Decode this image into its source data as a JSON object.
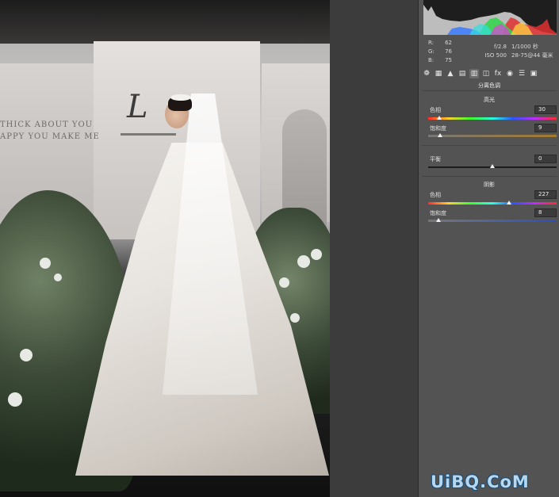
{
  "canvas": {
    "wall_text_line1": "THICK ABOUT YOU",
    "wall_text_line2": "APPY YOU MAKE ME",
    "monogram": "L"
  },
  "histogram": {
    "type": "rgb-histogram"
  },
  "readout": {
    "r_label": "R:",
    "r_value": "62",
    "g_label": "G:",
    "g_value": "76",
    "b_label": "B:",
    "b_value": "75",
    "aperture": "f/2.8",
    "shutter": "1/1000 秒",
    "iso": "ISO 500",
    "lens": "28-75@44 毫米"
  },
  "tabs": [
    {
      "icon": "aperture-icon",
      "glyph": "❁"
    },
    {
      "icon": "tone-curve-icon",
      "glyph": "▦"
    },
    {
      "icon": "detail-icon",
      "glyph": "▲"
    },
    {
      "icon": "hsl-icon",
      "glyph": "▤"
    },
    {
      "icon": "split-toning-icon",
      "glyph": "▥"
    },
    {
      "icon": "lens-corrections-icon",
      "glyph": "◫"
    },
    {
      "icon": "effects-icon",
      "glyph": "fx"
    },
    {
      "icon": "camera-calibration-icon",
      "glyph": "◉"
    },
    {
      "icon": "presets-icon",
      "glyph": "☰"
    },
    {
      "icon": "snapshots-icon",
      "glyph": "▣"
    }
  ],
  "panel": {
    "title": "分离色调",
    "highlights": {
      "title": "高光",
      "hue_label": "色相",
      "hue_value": "30",
      "hue": 30,
      "sat_label": "饱和度",
      "sat_value": "9",
      "saturation": 9
    },
    "balance": {
      "label": "平衡",
      "value": "0",
      "balance": 0
    },
    "shadows": {
      "title": "阴影",
      "hue_label": "色相",
      "hue_value": "227",
      "hue": 227,
      "sat_label": "饱和度",
      "sat_value": "8",
      "saturation": 8
    }
  },
  "watermark": "UiBQ.CoM",
  "colors": {
    "panel_bg": "#535353",
    "gutter_bg": "#3c3c3c",
    "watermark": "#b6d7ee"
  }
}
